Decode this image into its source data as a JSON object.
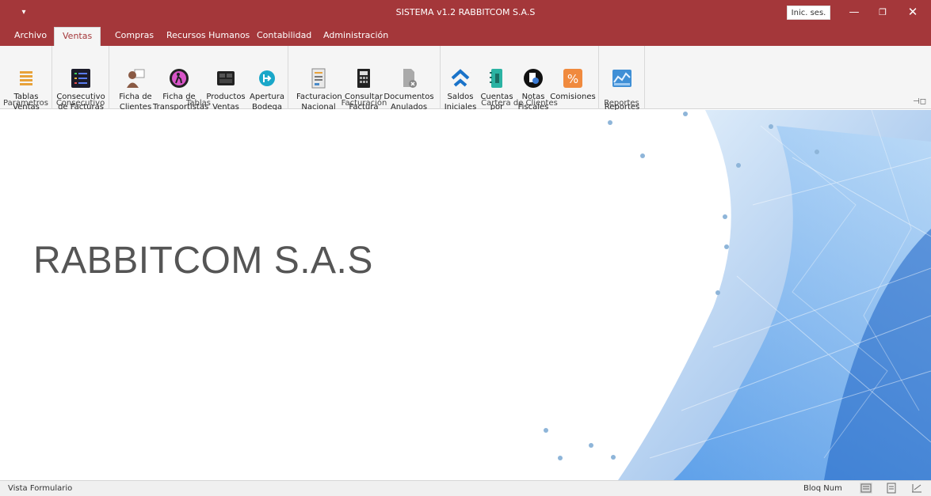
{
  "titlebar": {
    "title": "SISTEMA v1.2 RABBITCOM S.A.S",
    "signin_label": "Inic. ses.",
    "qat_icon": "quick-access-dropdown-icon"
  },
  "tabs": [
    "Archivo",
    "Ventas",
    "Compras",
    "Recursos Humanos",
    "Contabilidad",
    "Administración"
  ],
  "active_tab": "Ventas",
  "ribbon": {
    "groups": {
      "parametros": {
        "label": "Parametros",
        "buttons": [
          {
            "label": "Tablas\nVentas",
            "icon": "list-icon"
          }
        ]
      },
      "consecutivo": {
        "label": "Consecutivo",
        "buttons": [
          {
            "label": "Consecutivo\nde Facturas",
            "icon": "numbered-list-icon"
          }
        ]
      },
      "tablas": {
        "label": "Tablas",
        "buttons": [
          {
            "label": "Ficha de\nClientes",
            "icon": "client-card-icon"
          },
          {
            "label": "Ficha de\nTransportistas",
            "icon": "transporter-icon"
          },
          {
            "label": "Productos\nVentas",
            "icon": "products-icon"
          },
          {
            "label": "Apertura\nBodega",
            "icon": "warehouse-open-icon"
          }
        ]
      },
      "facturacion": {
        "label": "Facturación",
        "buttons": [
          {
            "label": "Facturacion\nNacional",
            "icon": "invoice-icon"
          },
          {
            "label": "Consultar\nFactura",
            "icon": "calculator-icon"
          },
          {
            "label": "Documentos\nAnulados",
            "icon": "cancelled-document-icon"
          }
        ]
      },
      "cartera": {
        "label": "Cartera de Clientes",
        "buttons": [
          {
            "label": "Saldos\nIniciales",
            "icon": "home-icon"
          },
          {
            "label": "Cuentas\npor Cobrar",
            "icon": "notebook-icon"
          },
          {
            "label": "Notas\nFiscales",
            "icon": "fiscal-note-icon"
          },
          {
            "label": "Comisiones",
            "icon": "percent-icon"
          }
        ]
      },
      "reportes": {
        "label": "Reportes",
        "buttons": [
          {
            "label": "Reportes",
            "icon": "chart-icon"
          }
        ]
      }
    }
  },
  "main": {
    "brand_text": "RABBITCOM S.A.S"
  },
  "statusbar": {
    "left_text": "Vista Formulario",
    "right_text": "Bloq Num"
  }
}
